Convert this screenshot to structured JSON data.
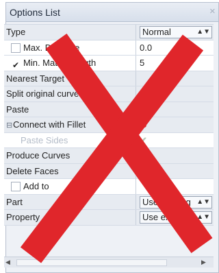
{
  "panel": {
    "title": "Options List",
    "close_glyph": "×"
  },
  "rows": {
    "type": {
      "label": "Type",
      "value": "Normal"
    },
    "max_distance": {
      "label": "Max. Distance",
      "value": "0.0"
    },
    "min_length": {
      "label": "Min. Match. length",
      "value": "5"
    },
    "nearest": {
      "label": "Nearest Target"
    },
    "split": {
      "label": "Split original curves"
    },
    "paste": {
      "label": "Paste",
      "state": "check"
    },
    "connect": {
      "label": "Connect with Fillet",
      "state": "cross"
    },
    "paste_sides": {
      "label": "Paste Sides",
      "state": "check-disabled"
    },
    "produce": {
      "label": "Produce Curves",
      "state": "cross"
    },
    "delete": {
      "label": "Delete Faces"
    },
    "add_to": {
      "label": "Add to"
    },
    "part": {
      "label": "Part",
      "value": "Use existing"
    },
    "property": {
      "label": "Property",
      "value": "Use existing"
    }
  },
  "glyphs": {
    "check": "✔",
    "cross": "✖",
    "combo_arrow": "▲▼",
    "expander": "⊟"
  },
  "colors": {
    "overlay_red": "#e0262b",
    "check_green": "#55b32f",
    "cross_red": "#d92929"
  }
}
